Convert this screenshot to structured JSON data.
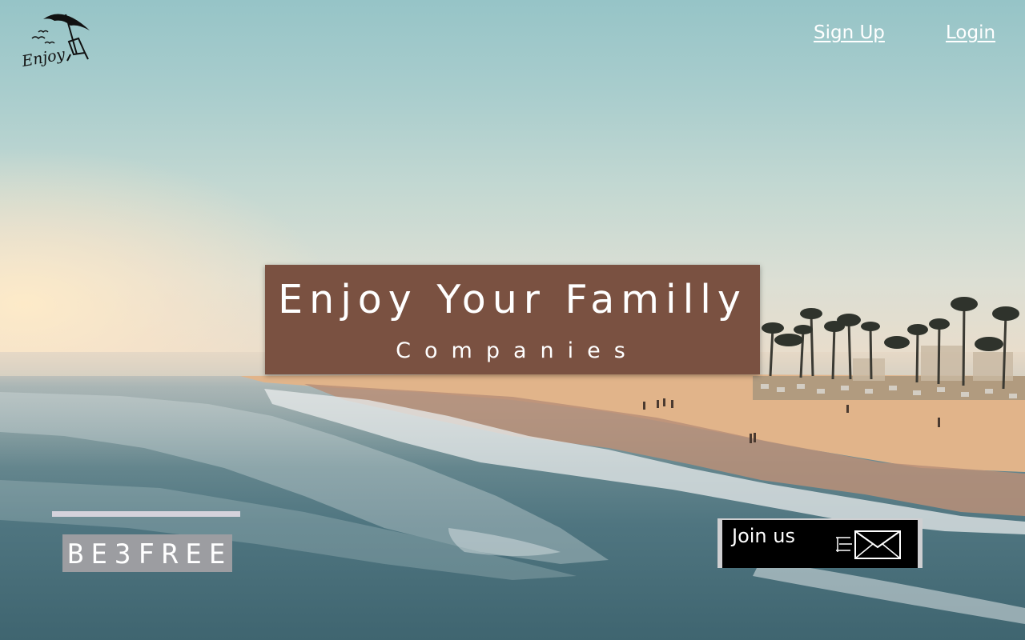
{
  "logo": {
    "text": "Enjoy"
  },
  "nav": {
    "signup": "Sign Up",
    "login": "Login"
  },
  "hero": {
    "title": "Enjoy Your Familly",
    "subtitle": "Companies"
  },
  "badge": {
    "text": "BE3FREE"
  },
  "cta": {
    "label": "Join us",
    "icon": "envelope-icon"
  },
  "colors": {
    "hero_bg": "#7a5141",
    "badge_bg": "#9c9da1",
    "cta_bg": "#000000",
    "nav_text": "#ffffff"
  }
}
